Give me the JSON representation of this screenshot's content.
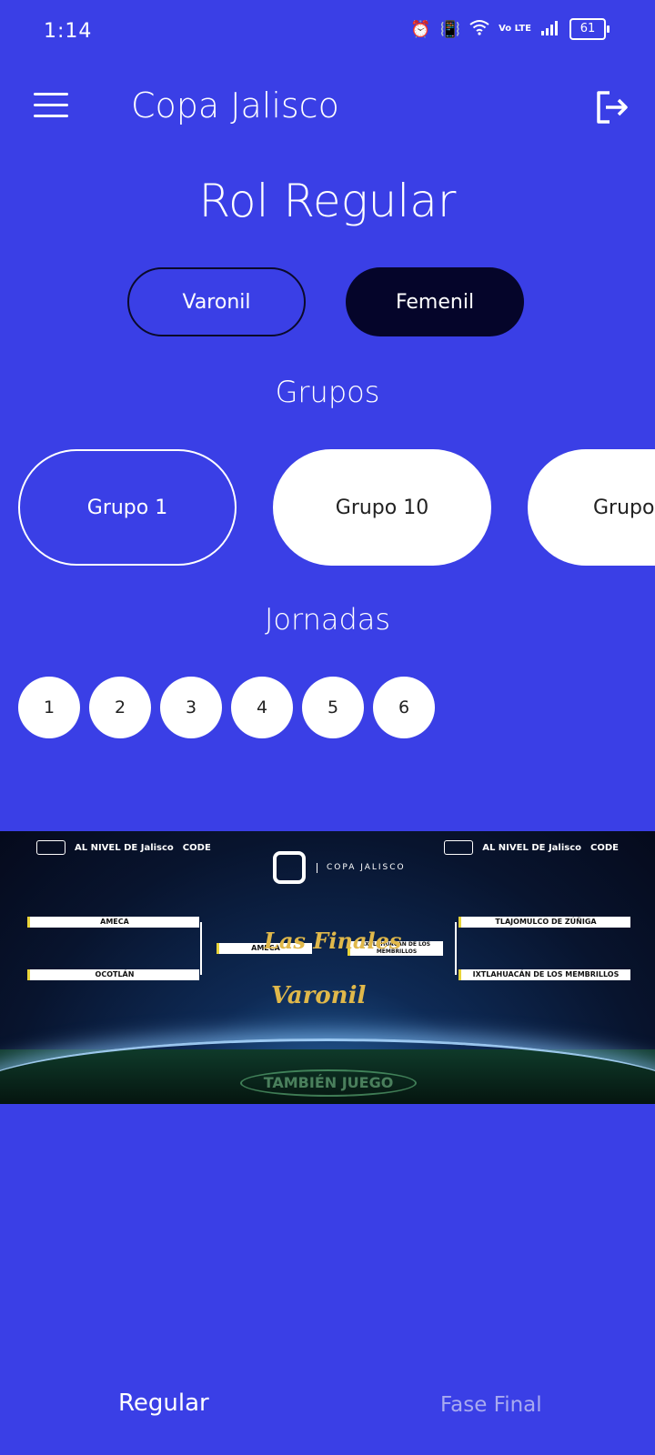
{
  "status_bar": {
    "time": "1:14",
    "icons": [
      "alarm-icon",
      "vibrate-icon",
      "wifi-icon",
      "volte-icon",
      "signal-icon",
      "battery-icon"
    ],
    "volte_label": "Vo LTE",
    "battery": "61"
  },
  "app_bar": {
    "title": "Copa Jalisco",
    "menu_icon": "hamburger-menu-icon",
    "logout_icon": "logout-icon"
  },
  "page": {
    "title": "Rol Regular"
  },
  "gender_toggle": {
    "varonil": "Varonil",
    "femenil": "Femenil",
    "selected": "Femenil"
  },
  "groups": {
    "title": "Grupos",
    "items": [
      "Grupo 1",
      "Grupo 10",
      "Grupo"
    ],
    "selected": "Grupo 1"
  },
  "jornadas": {
    "title": "Jornadas",
    "items": [
      "1",
      "2",
      "3",
      "4",
      "5",
      "6"
    ]
  },
  "banner": {
    "left_logos": [
      "AL NIVEL DE Jalisco",
      "CODE"
    ],
    "right_logos": [
      "AL NIVEL DE Jalisco",
      "CODE"
    ],
    "copa_logo_text": "COPA JALISCO",
    "finales_title": "Las Finales",
    "varonil_title": "Varonil",
    "teams": {
      "left_top": "AMECA",
      "left_bottom": "OCOTLÁN",
      "center_left": "AMECA",
      "center_right": "IXTLAHUACÁN DE LOS MEMBRILLOS",
      "right_top": "TLAJOMULCO DE ZÚÑIGA",
      "right_bottom": "IXTLAHUACÁN DE LOS MEMBRILLOS"
    },
    "field_text": "TAMBIÉN JUEGO"
  },
  "bottom_nav": {
    "regular": "Regular",
    "fase_final": "Fase Final",
    "selected": "Regular"
  },
  "colors": {
    "background": "#3a3fe6",
    "selected_toggle": "#05052a",
    "accent_gold": "#e0b84a",
    "inactive_nav": "#a8aaf0"
  }
}
